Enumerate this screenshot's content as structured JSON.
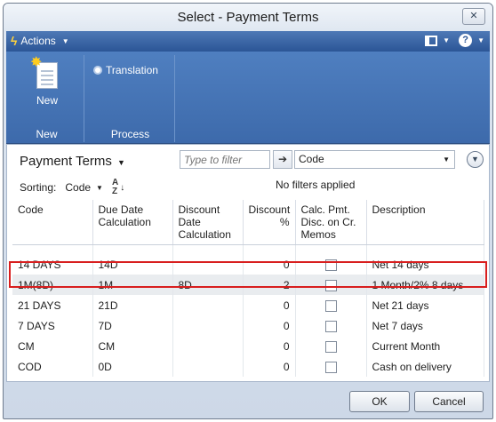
{
  "window": {
    "title": "Select - Payment Terms",
    "close_glyph": "✕"
  },
  "actionbar": {
    "menu_label": "Actions",
    "icons": [
      "lightning-icon",
      "layout-icon",
      "help-icon"
    ]
  },
  "ribbon": {
    "groups": [
      {
        "label": "New",
        "buttons": [
          {
            "label": "New",
            "icon": "new-document-icon"
          }
        ]
      },
      {
        "label": "Process",
        "buttons": [
          {
            "label": "Translation",
            "icon": "translation-icon"
          }
        ]
      }
    ]
  },
  "list": {
    "title": "Payment Terms",
    "filter": {
      "placeholder": "Type to filter",
      "field_value": "Code"
    },
    "sorting": {
      "label": "Sorting:",
      "field": "Code"
    },
    "filters_status": "No filters applied",
    "columns": [
      "Code",
      "Due Date Calculation",
      "Discount Date Calculation",
      "Discount %",
      "Calc. Pmt. Disc. on Cr. Memos",
      "Description"
    ],
    "rows": [
      {
        "code": "14 DAYS",
        "due": "14D",
        "discount_date": "",
        "discount_pct": "0",
        "calc": false,
        "description": "Net 14 days"
      },
      {
        "code": "1M(8D)",
        "due": "1M",
        "discount_date": "8D",
        "discount_pct": "2",
        "calc": false,
        "description": "1 Month/2% 8 days"
      },
      {
        "code": "21 DAYS",
        "due": "21D",
        "discount_date": "",
        "discount_pct": "0",
        "calc": false,
        "description": "Net 21 days"
      },
      {
        "code": "7 DAYS",
        "due": "7D",
        "discount_date": "",
        "discount_pct": "0",
        "calc": false,
        "description": "Net 7 days"
      },
      {
        "code": "CM",
        "due": "CM",
        "discount_date": "",
        "discount_pct": "0",
        "calc": false,
        "description": "Current Month"
      },
      {
        "code": "COD",
        "due": "0D",
        "discount_date": "",
        "discount_pct": "0",
        "calc": false,
        "description": "Cash on delivery"
      }
    ],
    "selected_row_code": "1M(8D)",
    "highlight_color": "#d81e1e"
  },
  "footer": {
    "ok_label": "OK",
    "cancel_label": "Cancel"
  },
  "colors": {
    "actionbar": "#2b5596",
    "ribbon": "#4f7fc0",
    "accent_icon": "#ffd23d"
  }
}
